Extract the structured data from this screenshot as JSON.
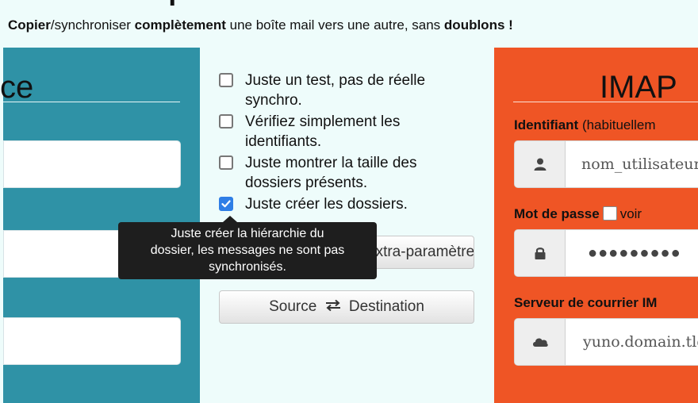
{
  "tagline": {
    "part1": "Copier",
    "part2": "/synchroniser ",
    "part3": "complètement",
    "part4": " une boîte mail vers une autre, sans ",
    "part5": "doublons !"
  },
  "source_panel": {
    "title_fragment": "ce",
    "color": "#2f92a6"
  },
  "options": [
    {
      "label": "Juste un test, pas de réelle synchro.",
      "checked": false
    },
    {
      "label": "Vérifiez simplement les identifiants.",
      "checked": false
    },
    {
      "label": "Juste montrer la taille des dossiers présents.",
      "checked": false
    },
    {
      "label": "Juste créer les dossiers.",
      "checked": true
    }
  ],
  "tooltip": {
    "line1": "Juste créer la hiérarchie du",
    "line2": "dossier, les messages ne sont pas",
    "line3": "synchronisés."
  },
  "buttons": {
    "extra_params_visible_label": "extra-paramètre",
    "swap_left": "Source",
    "swap_right": "Destination",
    "swap_icon": "swap-arrows-icon"
  },
  "destination_panel": {
    "title": "IMAP",
    "color": "#ef5525",
    "username_label": "Identifiant",
    "username_hint": " (habituellem",
    "username_placeholder": "nom_utilisateur",
    "username_icon": "user-icon",
    "password_label": "Mot de passe",
    "password_show_label": "voir",
    "password_value": "●●●●●●●●●",
    "password_icon": "lock-icon",
    "server_label": "Serveur de courrier IM",
    "server_placeholder": "yuno.domain.tld",
    "server_icon": "cloud-icon"
  }
}
